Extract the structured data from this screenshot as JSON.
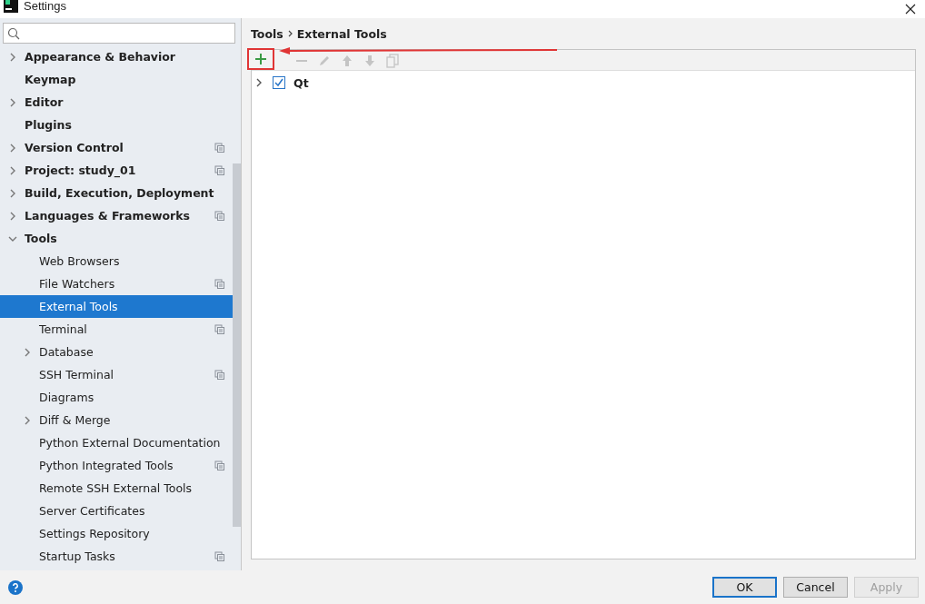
{
  "window": {
    "title": "Settings"
  },
  "sidebar": {
    "items": [
      {
        "label": "Appearance & Behavior",
        "expanded": false,
        "project_level": false,
        "selected": false
      },
      {
        "label": "Keymap",
        "project_level": false,
        "selected": false
      },
      {
        "label": "Editor",
        "expanded": false,
        "project_level": false,
        "selected": false
      },
      {
        "label": "Plugins",
        "project_level": false,
        "selected": false
      },
      {
        "label": "Version Control",
        "expanded": false,
        "project_level": true,
        "selected": false
      },
      {
        "label": "Project: study_01",
        "expanded": false,
        "project_level": true,
        "selected": false
      },
      {
        "label": "Build, Execution, Deployment",
        "expanded": false,
        "project_level": false,
        "selected": false
      },
      {
        "label": "Languages & Frameworks",
        "expanded": false,
        "project_level": true,
        "selected": false
      },
      {
        "label": "Tools",
        "expanded": true,
        "project_level": false,
        "selected": false,
        "children": [
          {
            "label": "Web Browsers",
            "project_level": false,
            "selected": false
          },
          {
            "label": "File Watchers",
            "project_level": true,
            "selected": false
          },
          {
            "label": "External Tools",
            "project_level": false,
            "selected": true
          },
          {
            "label": "Terminal",
            "project_level": true,
            "selected": false
          },
          {
            "label": "Database",
            "expanded": false,
            "project_level": false,
            "selected": false
          },
          {
            "label": "SSH Terminal",
            "project_level": true,
            "selected": false
          },
          {
            "label": "Diagrams",
            "project_level": false,
            "selected": false
          },
          {
            "label": "Diff & Merge",
            "expanded": false,
            "project_level": false,
            "selected": false
          },
          {
            "label": "Python External Documentation",
            "project_level": false,
            "selected": false
          },
          {
            "label": "Python Integrated Tools",
            "project_level": true,
            "selected": false
          },
          {
            "label": "Remote SSH External Tools",
            "project_level": false,
            "selected": false
          },
          {
            "label": "Server Certificates",
            "project_level": false,
            "selected": false
          },
          {
            "label": "Settings Repository",
            "project_level": false,
            "selected": false
          },
          {
            "label": "Startup Tasks",
            "project_level": true,
            "selected": false
          }
        ]
      }
    ]
  },
  "breadcrumb": [
    "Tools",
    "External Tools"
  ],
  "toolbar": [
    {
      "kind": "add",
      "disabled": false,
      "highlighted": true
    },
    {
      "kind": "remove",
      "disabled": true,
      "highlighted": false
    },
    {
      "kind": "edit",
      "disabled": true,
      "highlighted": false
    },
    {
      "kind": "up",
      "disabled": true,
      "highlighted": false
    },
    {
      "kind": "down",
      "disabled": true,
      "highlighted": false
    },
    {
      "kind": "copy",
      "disabled": true,
      "highlighted": false
    }
  ],
  "tools_tree": [
    {
      "label": "Qt",
      "expanded": false,
      "checked": true
    }
  ],
  "buttons": [
    {
      "label": "OK",
      "default": true,
      "disabled": false
    },
    {
      "label": "Cancel",
      "default": false,
      "disabled": false
    },
    {
      "label": "Apply",
      "default": false,
      "disabled": true
    }
  ]
}
